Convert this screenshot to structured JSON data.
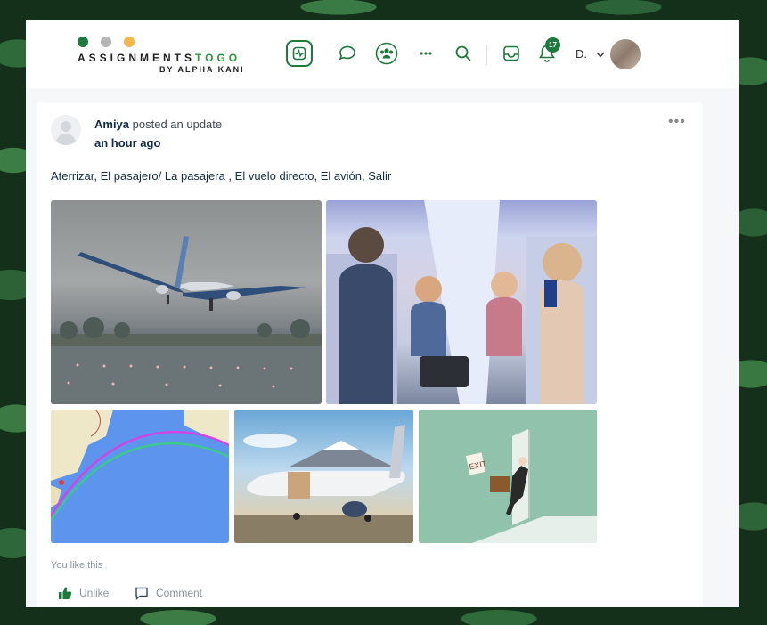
{
  "brand": {
    "logo_main_a": "ASSIGNMENTS",
    "logo_main_b": "TOGO",
    "logo_sub": "BY ALPHA KANI",
    "dot_colors": [
      "#1e7a3c",
      "#b5b5b5",
      "#f2b94a"
    ]
  },
  "nav": {
    "items": [
      "activity-icon",
      "messages-icon",
      "groups-icon",
      "more-icon",
      "search-icon",
      "inbox-icon",
      "notifications-icon"
    ],
    "notification_count": "17",
    "user_initial": "D."
  },
  "post": {
    "author": "Amiya",
    "action": " posted an update",
    "time": "an hour ago",
    "text": "Aterrizar, El pasajero/ La pasajera , El vuelo directo, El avión, Salir",
    "photos": [
      "airplane landing in rain",
      "passengers in airplane cabin",
      "flight route map",
      "airplane on tarmac with mountain",
      "person exiting through exit door"
    ],
    "likes_text": "You like this",
    "unlike_label": "Unlike",
    "comment_label": "Comment"
  },
  "colors": {
    "accent": "#1e7a3c",
    "text": "#122b46",
    "muted": "#8a959e"
  }
}
